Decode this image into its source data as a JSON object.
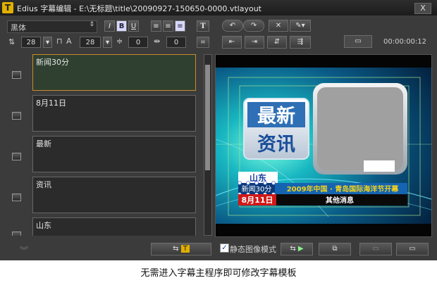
{
  "window": {
    "title": "Edius 字幕编辑 - E:\\无标题\\title\\20090927-150650-0000.vtlayout",
    "close_label": "X"
  },
  "toolbar": {
    "font_name": "黑体",
    "bold_label": "B",
    "italic_label": "I",
    "underline_label": "U",
    "text_tool_label": "T",
    "font_size_1": "28",
    "font_size_2": "28",
    "spacing_1": "0",
    "spacing_2": "0",
    "timecode": "00:00:00:12"
  },
  "layers": [
    {
      "text": "新闻30分",
      "selected": true
    },
    {
      "text": "8月11日",
      "selected": false
    },
    {
      "text": "最新",
      "selected": false
    },
    {
      "text": "资讯",
      "selected": false
    },
    {
      "text": "山东",
      "selected": false
    }
  ],
  "preview": {
    "badge_line1": "最新",
    "badge_line2": "资讯",
    "shandong": "山东",
    "program": "新闻30分",
    "ticker": "2009年中国 · 青岛国际海洋节开幕",
    "date": "8月11日",
    "other": "其他消息"
  },
  "bottom": {
    "static_image_mode": "静态图像模式",
    "static_checked": true
  },
  "caption": "无需进入字幕主程序即可修改字幕模板",
  "colors": {
    "selected_border": "#c98a2c",
    "teal": "#1fb3c8",
    "ticker_yellow": "#f2d21a"
  }
}
